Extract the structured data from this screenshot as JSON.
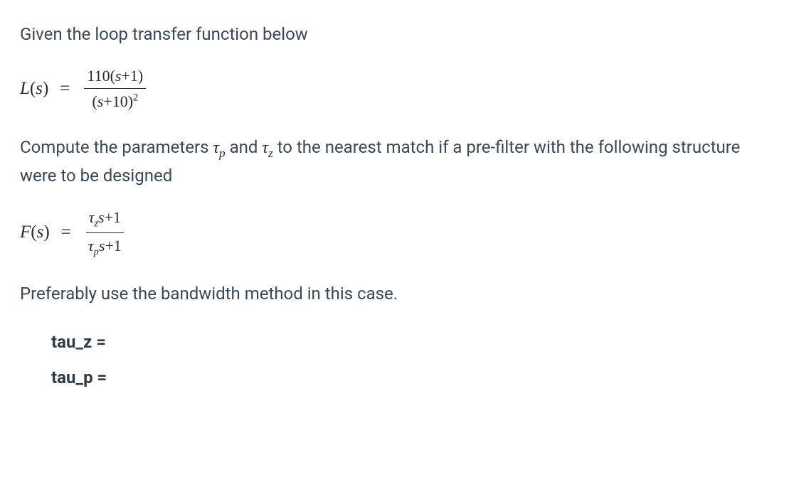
{
  "para1": "Given the loop transfer function below",
  "eq1": {
    "lhs_var": "L",
    "lhs_arg": "s",
    "num_coeff": "110",
    "num_inner": "s+1",
    "den_inner": "s+10",
    "den_exp": "2"
  },
  "para2_a": "Compute the parameters ",
  "para2_tau1_sym": "τ",
  "para2_tau1_sub": "p",
  "para2_b": " and ",
  "para2_tau2_sym": "τ",
  "para2_tau2_sub": "z",
  "para2_c": " to the nearest match if a pre-filter with the following structure were to be designed",
  "eq2": {
    "lhs_var": "F",
    "lhs_arg": "s",
    "num_tau": "τ",
    "num_sub": "z",
    "num_tail": "s+1",
    "den_tau": "τ",
    "den_sub": "p",
    "den_tail": "s+1"
  },
  "para3": "Preferably use the bandwidth method in this case.",
  "answers": {
    "tau_z_label": "tau_z =",
    "tau_p_label": "tau_p ="
  }
}
